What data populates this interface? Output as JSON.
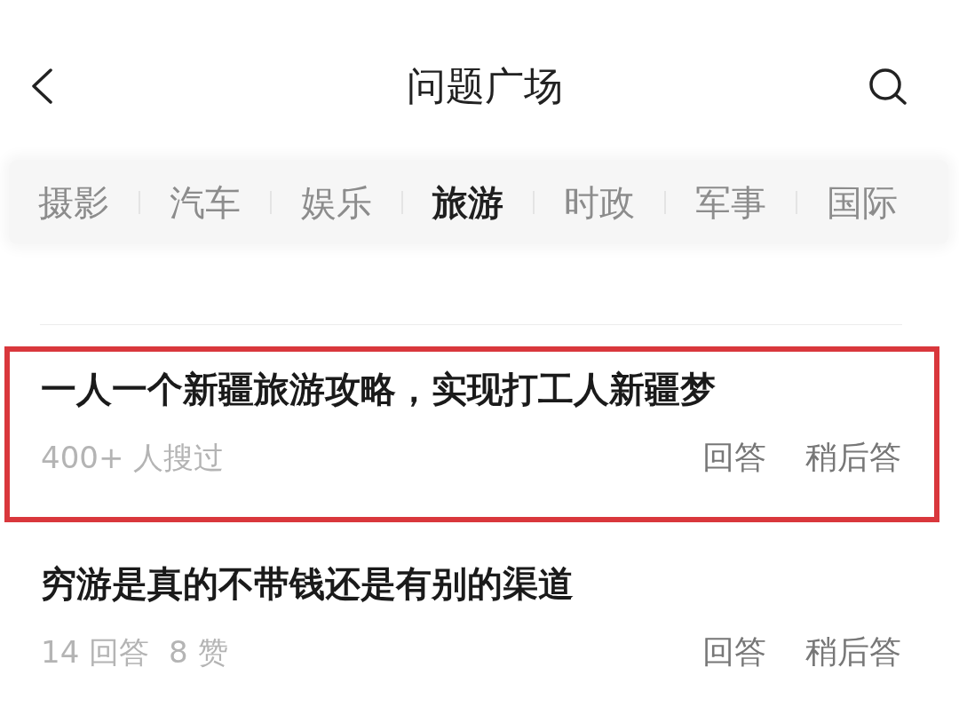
{
  "header": {
    "title": "问题广场"
  },
  "tabs": [
    {
      "label": "摄影",
      "selected": false
    },
    {
      "label": "汽车",
      "selected": false
    },
    {
      "label": "娱乐",
      "selected": false
    },
    {
      "label": "旅游",
      "selected": true
    },
    {
      "label": "时政",
      "selected": false
    },
    {
      "label": "军事",
      "selected": false
    },
    {
      "label": "国际",
      "selected": false
    }
  ],
  "questions": [
    {
      "title": "一人一个新疆旅游攻略，实现打工人新疆梦",
      "meta": [
        "400+ 人搜过"
      ],
      "actions": [
        "回答",
        "稍后答"
      ],
      "highlighted": true
    },
    {
      "title": "穷游是真的不带钱还是有别的渠道",
      "meta": [
        "14 回答",
        "8 赞"
      ],
      "actions": [
        "回答",
        "稍后答"
      ],
      "highlighted": false
    }
  ]
}
